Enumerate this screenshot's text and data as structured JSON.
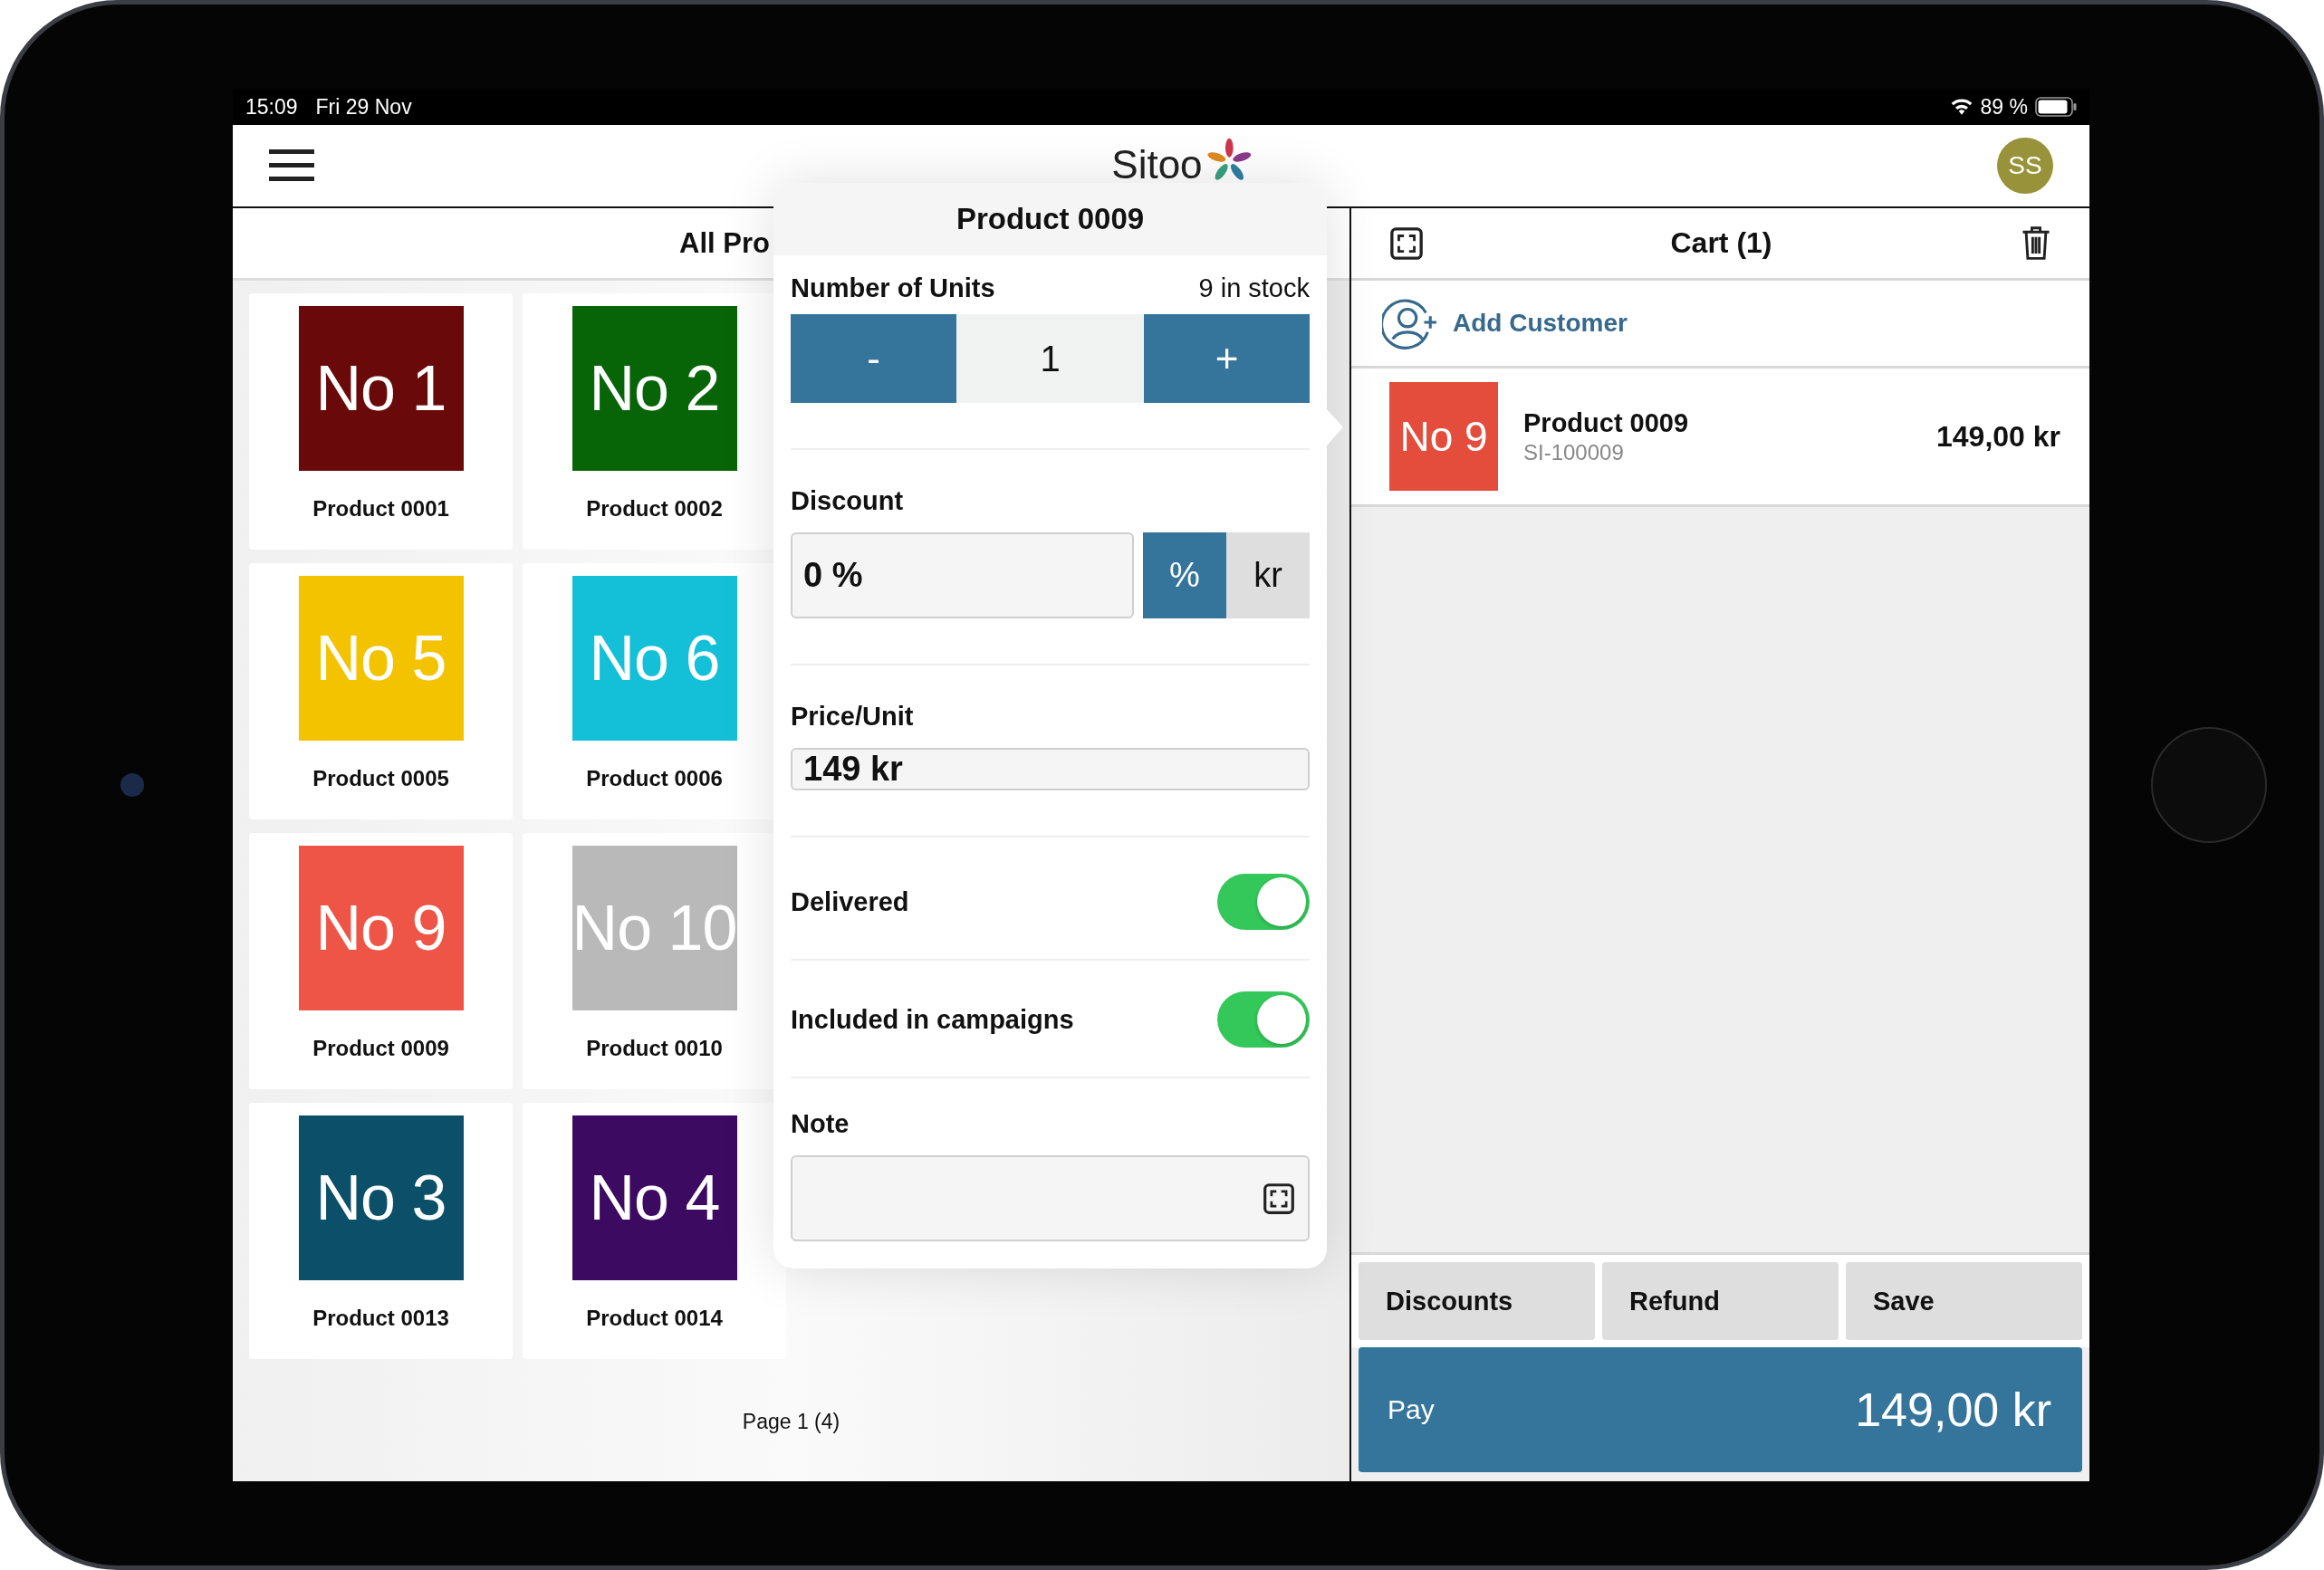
{
  "status_bar": {
    "time": "15:09",
    "date": "Fri 29 Nov",
    "battery": "89 %"
  },
  "header": {
    "logo": "Sitoo",
    "avatar": "SS"
  },
  "products": {
    "title": "All Pro",
    "items": [
      {
        "tile": "No 1",
        "name": "Product 0001",
        "color": "#6a0909"
      },
      {
        "tile": "No 2",
        "name": "Product 0002",
        "color": "#076508"
      },
      {
        "tile": "No 5",
        "name": "Product 0005",
        "color": "#f4c300"
      },
      {
        "tile": "No 6",
        "name": "Product 0006",
        "color": "#14c0d8"
      },
      {
        "tile": "No 9",
        "name": "Product 0009",
        "color": "#ee5546"
      },
      {
        "tile": "No 10",
        "name": "Product 0010",
        "color": "#b9b9b9"
      },
      {
        "tile": "No 3",
        "name": "Product 0013",
        "color": "#0b4f68"
      },
      {
        "tile": "No 4",
        "name": "Product 0014",
        "color": "#3d0a62"
      }
    ],
    "page": "Page 1 (4)"
  },
  "popup": {
    "title": "Product 0009",
    "units": {
      "label": "Number of Units",
      "stock": "9 in stock",
      "minus": "-",
      "value": "1",
      "plus": "+"
    },
    "discount": {
      "label": "Discount",
      "value": "0 %",
      "units": [
        {
          "label": "%",
          "selected": true
        },
        {
          "label": "kr",
          "selected": false
        }
      ]
    },
    "price": {
      "label": "Price/Unit",
      "value": "149 kr"
    },
    "toggles": [
      {
        "label": "Delivered",
        "on": true
      },
      {
        "label": "Included in campaigns",
        "on": true
      }
    ],
    "note": {
      "label": "Note"
    }
  },
  "cart": {
    "title": "Cart (1)",
    "add_customer": "Add Customer",
    "items": [
      {
        "tile": "No 9",
        "color": "#e44c3c",
        "name": "Product 0009",
        "sku": "SI-100009",
        "price": "149,00 kr"
      }
    ],
    "actions": [
      "Discounts",
      "Refund",
      "Save"
    ],
    "pay": {
      "label": "Pay",
      "amount": "149,00 kr"
    }
  }
}
